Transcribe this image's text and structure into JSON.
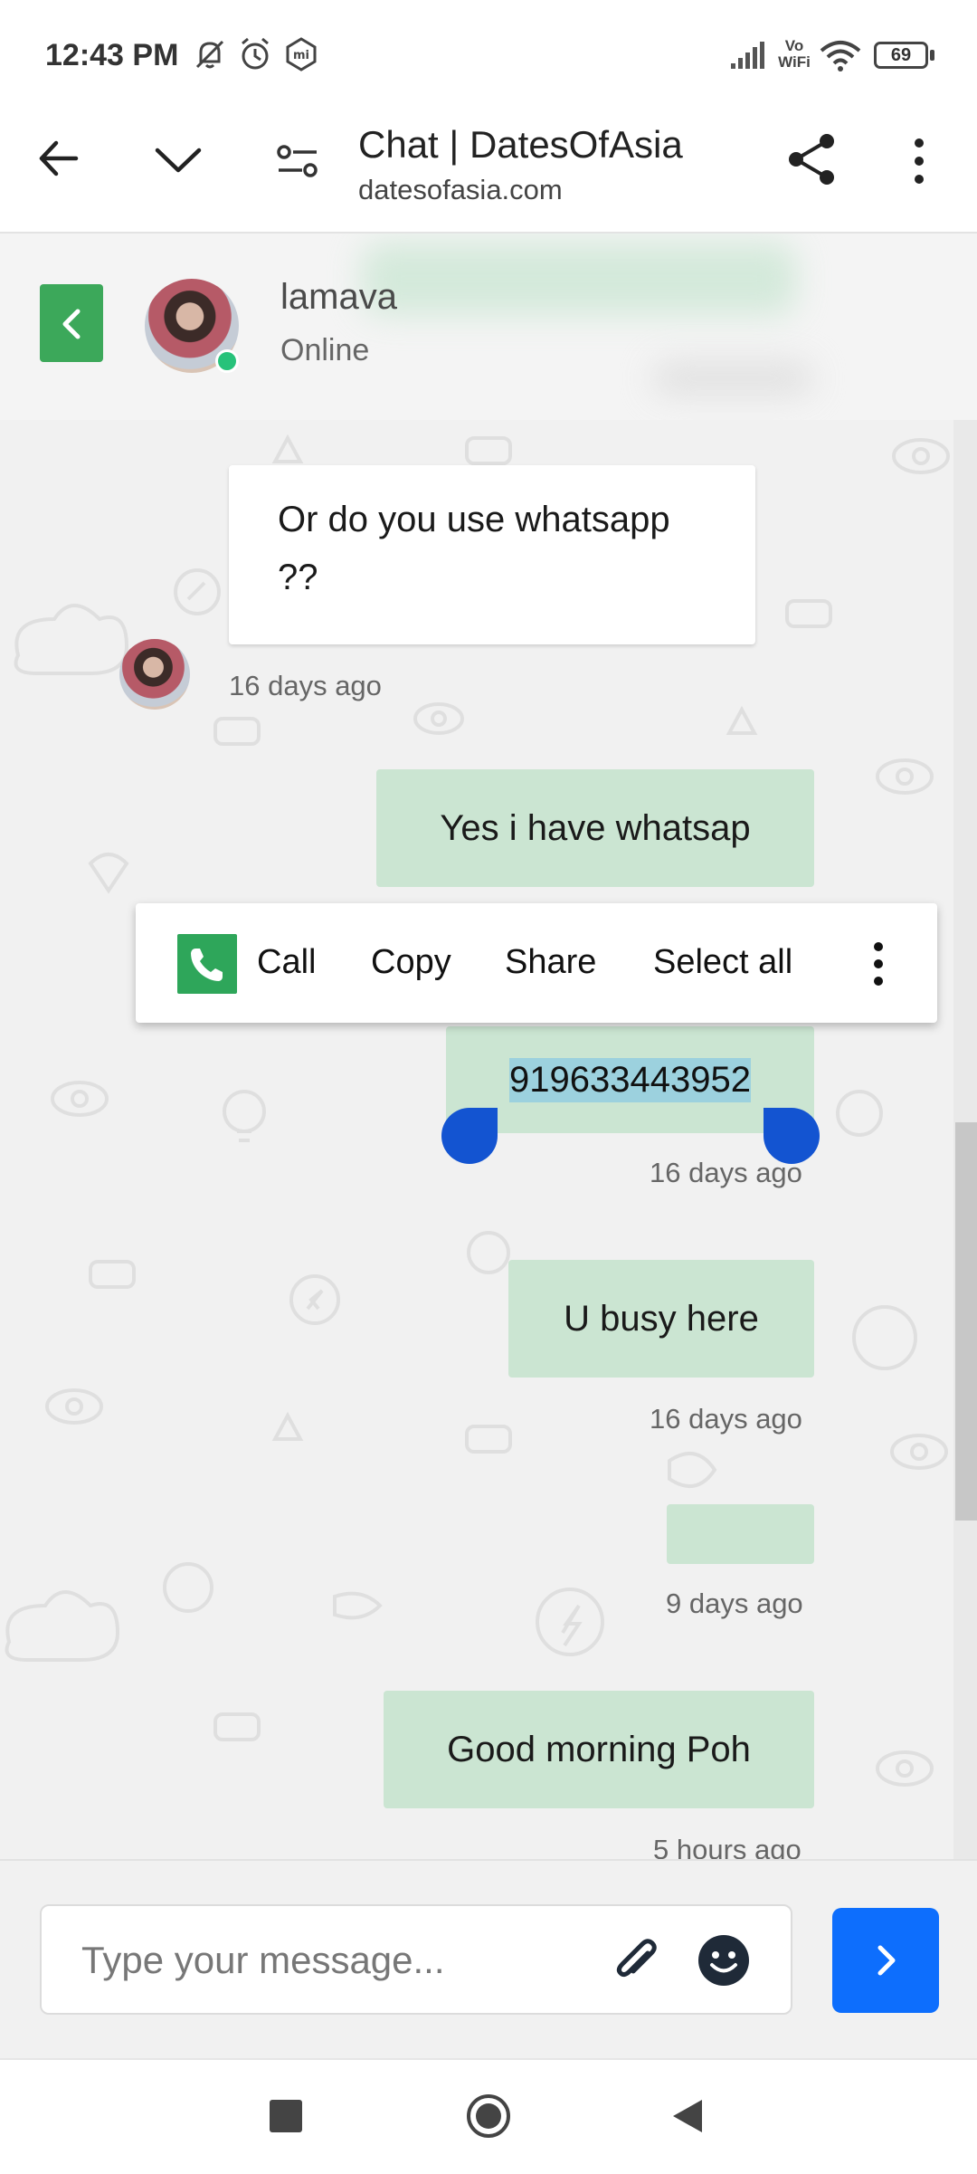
{
  "status_bar": {
    "time": "12:43 PM",
    "icons": [
      "muted-bell-icon",
      "alarm-icon",
      "mi-icon",
      "signal-icon",
      "vowifi-icon",
      "wifi-icon",
      "battery-icon"
    ],
    "vowifi_top": "Vo",
    "vowifi_bottom": "WiFi",
    "battery": "69"
  },
  "browser": {
    "title": "Chat | DatesOfAsia",
    "url": "datesofasia.com"
  },
  "chat_header": {
    "name": "lamava",
    "status": "Online",
    "accent": "#3ca85a"
  },
  "messages": [
    {
      "direction": "in",
      "text": "Or do you use whatsapp ??",
      "time": "16 days ago"
    },
    {
      "direction": "out",
      "text": "Yes i have whatsap",
      "time": ""
    },
    {
      "direction": "out",
      "text": "919633443952",
      "time": "16 days ago"
    },
    {
      "direction": "out",
      "text": "U busy here",
      "time": "16 days ago"
    },
    {
      "direction": "out",
      "text": "",
      "time": "9 days ago"
    },
    {
      "direction": "out",
      "text": "Good morning Poh",
      "time": "5 hours ago"
    }
  ],
  "context_menu": {
    "call": "Call",
    "copy": "Copy",
    "share": "Share",
    "select_all": "Select all"
  },
  "composer": {
    "placeholder": "Type your message...",
    "send_color": "#0d6efd"
  },
  "colors": {
    "outgoing_bubble": "#cbe5d2",
    "incoming_bubble": "#ffffff",
    "selection_handle": "#1354d1",
    "selection_highlight": "#9cd1de"
  }
}
